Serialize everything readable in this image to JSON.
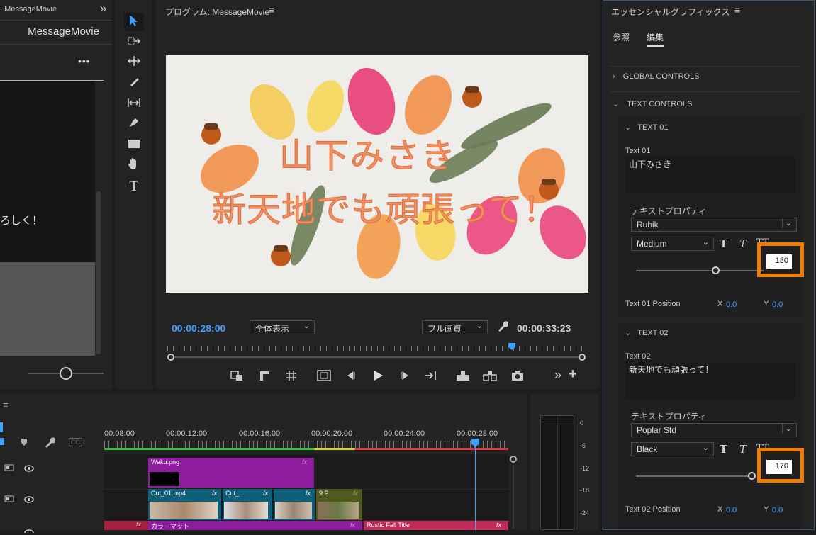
{
  "source_panel": {
    "title_prefix": ": MessageMovie",
    "title": "MessageMovie",
    "more": "•••",
    "text_snippet": "ろしく！",
    "expand_icon": "»"
  },
  "program": {
    "title": "プログラム: MessageMovie",
    "menu": "≡",
    "timecode": "00:00:28:00",
    "zoom": "全体表示",
    "quality": "フル画質",
    "duration": "00:00:33:23",
    "text_line1": "山下みさき",
    "text_line2": "新天地でも頑張って！"
  },
  "essential_graphics": {
    "title": "エッセンシャルグラフィックス",
    "menu": "≡",
    "tabs": [
      "参照",
      "編集"
    ],
    "active_tab": "編集",
    "global_controls": "GLOBAL CONTROLS",
    "text_controls": "TEXT CONTROLS",
    "text01": {
      "header": "TEXT 01",
      "label": "Text 01",
      "value": "山下みさき",
      "props_label": "テキストプロパティ",
      "font": "Rubik",
      "style": "Medium",
      "size": "180",
      "position_label": "Text 01 Position",
      "x_label": "X",
      "x": "0.0",
      "y_label": "Y",
      "y": "0.0",
      "slider_value": 0.5
    },
    "text02": {
      "header": "TEXT 02",
      "label": "Text 02",
      "value": "新天地でも頑張って！",
      "props_label": "テキストプロパティ",
      "font": "Poplar Std",
      "style": "Black",
      "size": "170",
      "position_label": "Text 02 Position",
      "x_label": "X",
      "x": "0.0",
      "y_label": "Y",
      "y": "0.0",
      "slider_value": 0.94
    }
  },
  "timeline": {
    "menu": "≡",
    "ticks": [
      "00:08:00",
      "00:00:12:00",
      "00:00:16:00",
      "00:00:20:00",
      "00:00:24:00",
      "00:00:28:00"
    ],
    "clips": {
      "waku": "Waku.png",
      "cut01": "Cut_01.mp4",
      "cut2": "Cut_",
      "p9": "9 P",
      "colormatte": "カラーマット",
      "rustic": "Rustic Fall Title",
      "fx": "fx"
    },
    "cc": "CC"
  },
  "meter": {
    "labels": [
      "0",
      "-6",
      "-12",
      "-18",
      "-24"
    ]
  },
  "colors": {
    "accent": "#3fa0ff",
    "highlight": "#f07c00",
    "clip_purple": "#8e1e9e",
    "clip_teal": "#0f5f78",
    "clip_pink": "#c02a58"
  }
}
